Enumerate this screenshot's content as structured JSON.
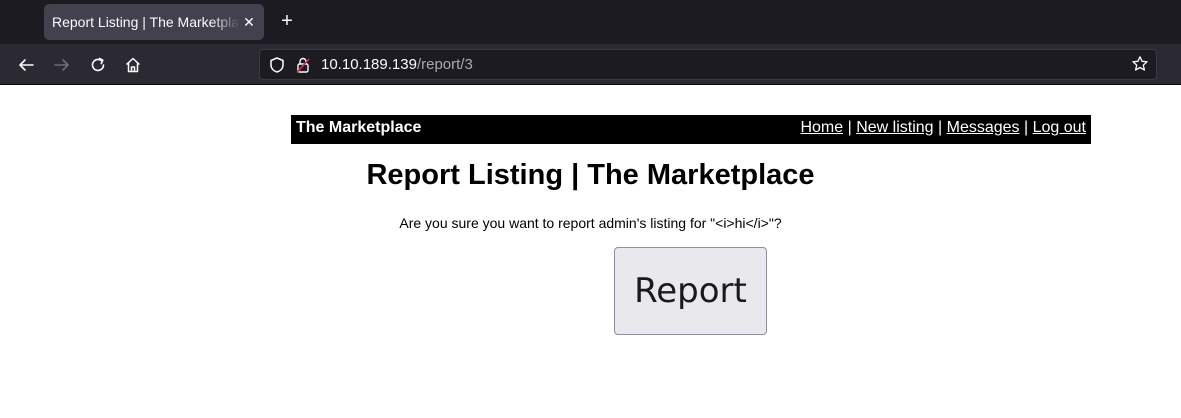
{
  "browser": {
    "tab_title": "Report Listing | The Marketplace",
    "tab_close": "✕",
    "new_tab": "+",
    "url_host": "10.10.189.139",
    "url_path": "/report/3"
  },
  "header": {
    "site_name": "The Marketplace",
    "nav": {
      "home": "Home",
      "new_listing": "New listing",
      "messages": "Messages",
      "logout": "Log out",
      "separator": "|"
    }
  },
  "main": {
    "title": "Report Listing | The Marketplace",
    "confirm_text": "Are you sure you want to report admin's listing for \"<i>hi</i>\"?",
    "report_button": "Report"
  }
}
